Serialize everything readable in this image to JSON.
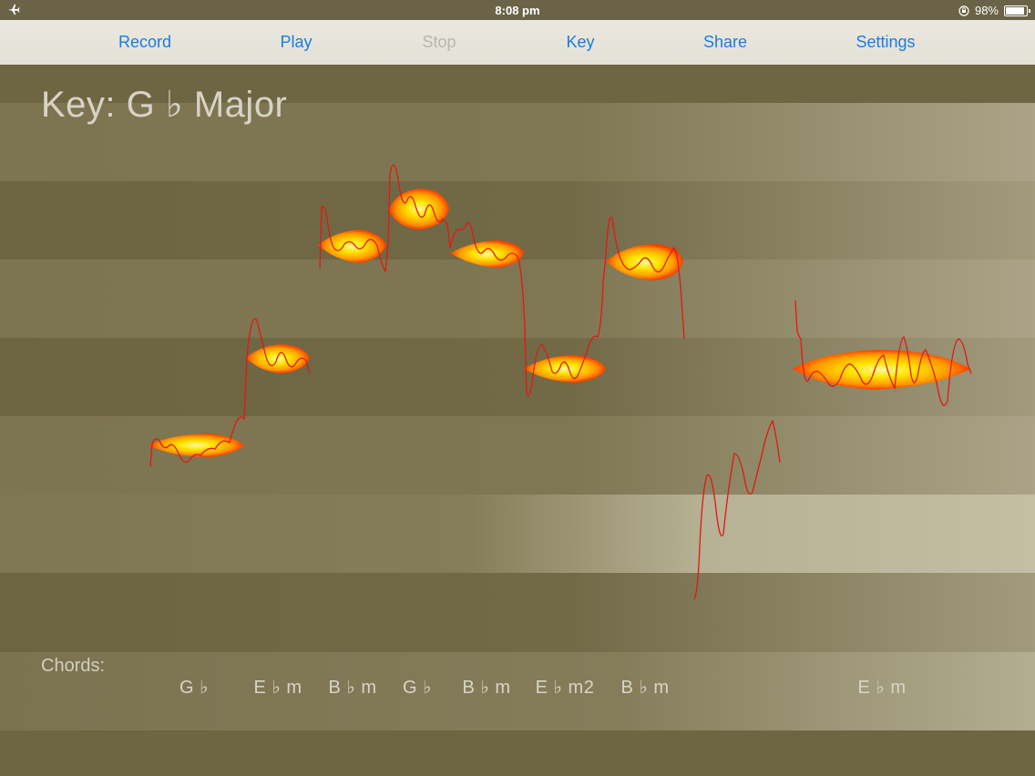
{
  "status_bar": {
    "time": "8:08 pm",
    "battery_text": "98%",
    "battery_level": 0.98,
    "icons": [
      "airplane-icon",
      "orientation-lock-icon",
      "battery-icon"
    ]
  },
  "toolbar": {
    "record_label": "Record",
    "play_label": "Play",
    "stop_label": "Stop",
    "key_label": "Key",
    "share_label": "Share",
    "settings_label": "Settings",
    "stop_disabled": true,
    "accent_color": "#1a7ce6"
  },
  "key_display": {
    "text": "Key: G ♭ Major"
  },
  "chords": {
    "label": "Chords:",
    "items": [
      "G ♭",
      "E ♭ m",
      "B ♭ m",
      "G ♭",
      "B ♭ m",
      "E ♭ m2",
      "B ♭ m",
      "E ♭ m"
    ]
  },
  "colors": {
    "background": "#6e6642",
    "note_blob_outer": "#ff4a00",
    "note_blob_inner": "#ffe600",
    "pitch_line": "#e01a10",
    "toolbar_bg": "#e8e5dc"
  }
}
